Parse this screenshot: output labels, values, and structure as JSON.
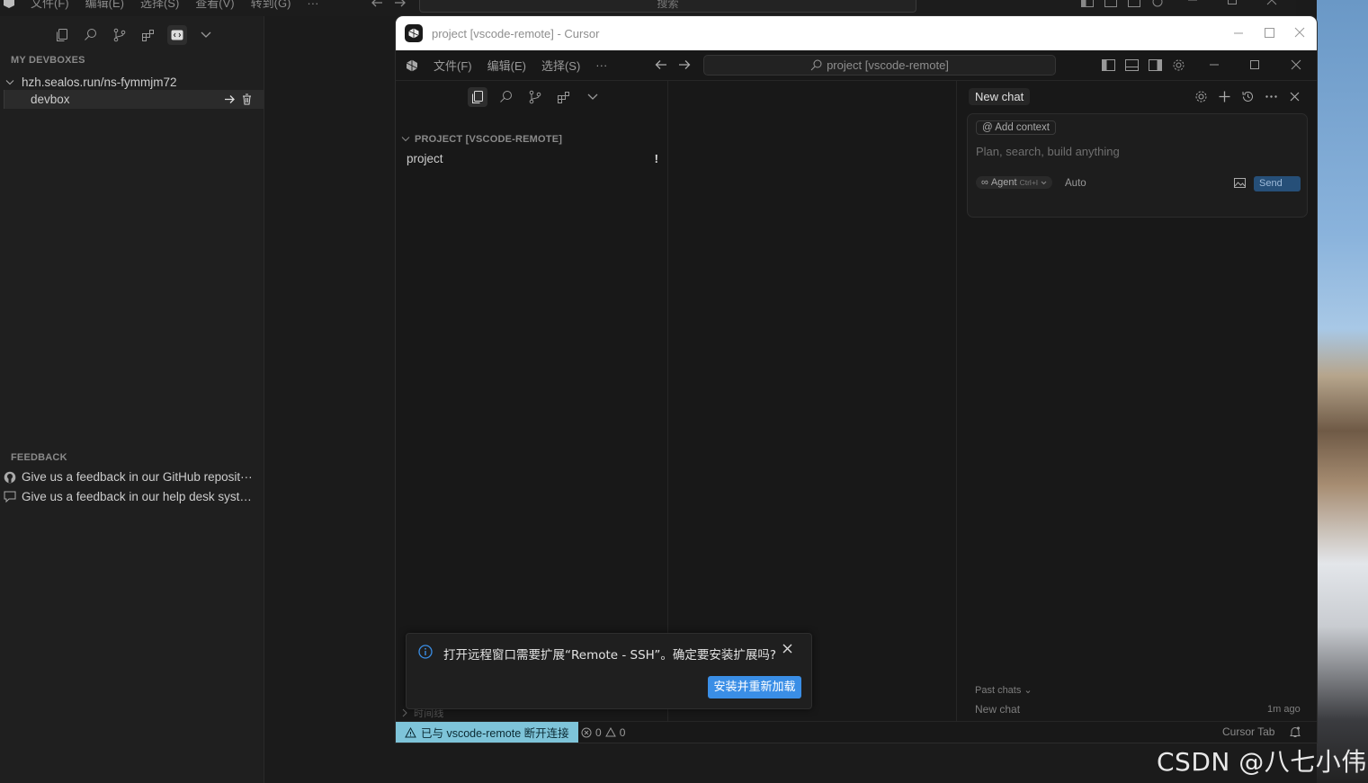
{
  "background_window": {
    "menu": [
      "文件(F)",
      "编辑(E)",
      "选择(S)",
      "查看(V)",
      "转到(G)",
      "···"
    ],
    "search_placeholder": "搜索",
    "sections": {
      "devboxes_header": "MY DEVBOXES",
      "host": "hzh.sealos.run/ns-fymmjm72",
      "devbox_name": "devbox",
      "feedback_header": "FEEDBACK",
      "feedback_items": [
        "Give us a feedback in our GitHub reposit···",
        "Give us a feedback in our help desk syste···"
      ]
    }
  },
  "window": {
    "title": "project [vscode-remote] - Cursor",
    "menu": [
      "文件(F)",
      "编辑(E)",
      "选择(S)",
      "···"
    ],
    "command_center": "project [vscode-remote]"
  },
  "explorer": {
    "header": "PROJECT [VSCODE-REMOTE]",
    "item": "project",
    "item_badge": "!",
    "timeline_label": "时间线"
  },
  "chat": {
    "tab": "New chat",
    "add_context": "Add context",
    "placeholder": "Plan, search, build anything",
    "agent_label": "Agent",
    "agent_shortcut": "Ctrl+I",
    "model": "Auto",
    "send_label": "Send",
    "past_chats_label": "Past chats",
    "recent_chat_title": "New chat",
    "recent_chat_time": "1m ago"
  },
  "notification": {
    "message": "打开远程窗口需要扩展“Remote - SSH”。确定要安装扩展吗?",
    "action_label": "安装并重新加载"
  },
  "statusbar": {
    "remote_status": "已与 vscode-remote 断开连接",
    "errors": "0",
    "warnings": "0",
    "cursor_tab": "Cursor Tab"
  },
  "watermark": "CSDN @八七小伟",
  "colors": {
    "accent": "#3a8ee6",
    "remote_badge": "#7ec4d9",
    "send_button": "#264f78"
  }
}
